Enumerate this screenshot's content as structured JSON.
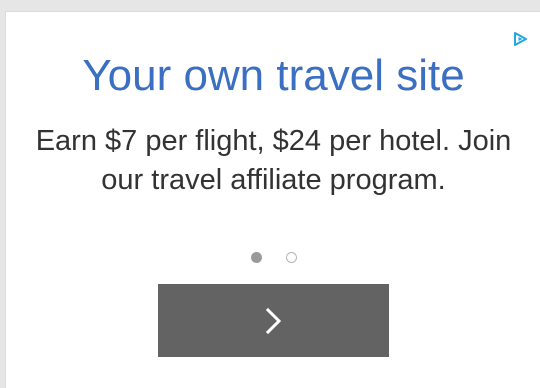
{
  "ad": {
    "headline": "Your own travel site",
    "body": "Earn $7 per flight, $24 per hotel. Join our travel affiliate program.",
    "carousel": {
      "total_slides": 2,
      "active_slide": 1
    },
    "next_button_icon": "chevron-right-icon",
    "adchoices_icon": "adchoices-triangle-icon"
  },
  "colors": {
    "headline": "#3b6fc2",
    "body_text": "#333333",
    "button_bg": "#636363",
    "adchoices": "#22a7e0",
    "dot_active": "#9a9a9a",
    "dot_inactive": "#b5b5b5"
  }
}
